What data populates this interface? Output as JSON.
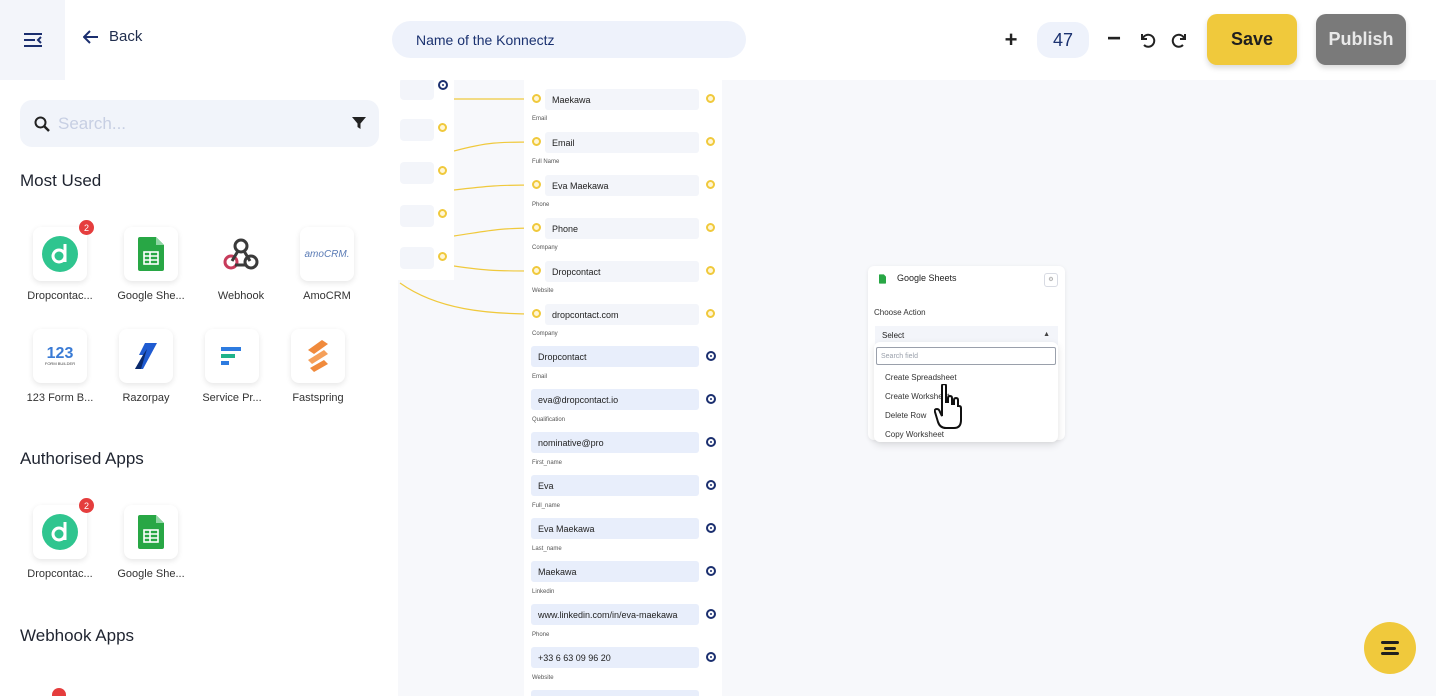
{
  "header": {
    "back_label": "Back",
    "konnectz_name": "Name of the Konnectz",
    "zoom_level": "47",
    "save_label": "Save",
    "publish_label": "Publish"
  },
  "sidebar": {
    "search_placeholder": "Search...",
    "sections": {
      "most_used": "Most Used",
      "authorised": "Authorised Apps",
      "webhook": "Webhook Apps"
    },
    "most_used_apps": [
      {
        "label": "Dropcontac...",
        "icon": "dropcontact-icon",
        "badge": "2"
      },
      {
        "label": "Google She...",
        "icon": "google-sheets-icon"
      },
      {
        "label": "Webhook",
        "icon": "webhook-icon"
      },
      {
        "label": "AmoCRM",
        "icon": "amocrm-icon",
        "logo_text": "amoCRM."
      },
      {
        "label": "123 Form B...",
        "icon": "123-form-builder-icon",
        "logo_text": "123",
        "logo_subtext": "FORM BUILDER"
      },
      {
        "label": "Razorpay",
        "icon": "razorpay-icon"
      },
      {
        "label": "Service Pr...",
        "icon": "service-provider-icon"
      },
      {
        "label": "Fastspring",
        "icon": "fastspring-icon"
      }
    ],
    "authorised_apps": [
      {
        "label": "Dropcontac...",
        "icon": "dropcontact-icon",
        "badge": "2"
      },
      {
        "label": "Google She...",
        "icon": "google-sheets-icon"
      }
    ]
  },
  "mapping": {
    "source_fields": [
      {
        "value": "Maekawa",
        "label": "Email"
      },
      {
        "value": "Email",
        "label": "Full Name"
      },
      {
        "value": "Eva Maekawa",
        "label": "Phone"
      },
      {
        "value": "Phone",
        "label": "Company"
      },
      {
        "value": "Dropcontact",
        "label": "Website"
      },
      {
        "value": "dropcontact.com",
        "label": "Company"
      }
    ],
    "output_fields": [
      {
        "value": "Dropcontact",
        "label": "Email"
      },
      {
        "value": "eva@dropcontact.io",
        "label": "Qualification"
      },
      {
        "value": "nominative@pro",
        "label": "First_name"
      },
      {
        "value": "Eva",
        "label": "Full_name"
      },
      {
        "value": "Eva Maekawa",
        "label": "Last_name"
      },
      {
        "value": "Maekawa",
        "label": "Linkedin"
      },
      {
        "value": "www.linkedin.com/in/eva-maekawa",
        "label": "Phone"
      },
      {
        "value": "+33 6 63 09 96 20",
        "label": "Website"
      }
    ]
  },
  "google_sheets_node": {
    "title": "Google Sheets",
    "choose_action_label": "Choose Action",
    "select_value": "Select",
    "search_placeholder": "Search field",
    "options": [
      "Create Spreadsheet",
      "Create Worksheet",
      "Delete Row",
      "Copy Worksheet"
    ]
  },
  "colors": {
    "accent_yellow": "#f0c93c",
    "navy": "#1b2f6f",
    "publish_gray": "#7a7a7a"
  }
}
